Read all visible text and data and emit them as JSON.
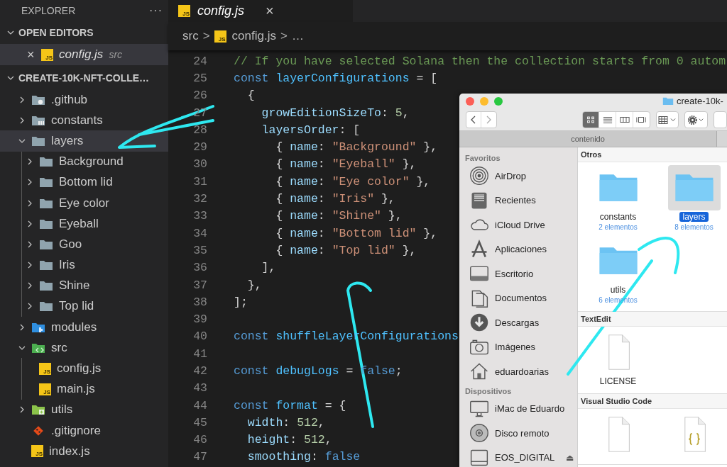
{
  "sidebar": {
    "title": "EXPLORER",
    "more": "···",
    "open_editors": {
      "title": "OPEN EDITORS",
      "expanded": true,
      "files": [
        {
          "close": "×",
          "badge": "JS",
          "name": "config.js",
          "folder": "src",
          "selected": true
        }
      ]
    },
    "project": {
      "title": "CREATE-10K-NFT-COLLE…",
      "expanded": true,
      "tree": [
        {
          "name": ".github",
          "kind": "github",
          "expanded": false,
          "selected": false
        },
        {
          "name": "constants",
          "kind": "constants",
          "expanded": false,
          "selected": false
        },
        {
          "name": "layers",
          "kind": "folder",
          "expanded": true,
          "selected": true,
          "children": [
            {
              "name": "Background",
              "kind": "folder",
              "expanded": false,
              "selected": false
            },
            {
              "name": "Bottom lid",
              "kind": "folder",
              "expanded": false,
              "selected": false
            },
            {
              "name": "Eye color",
              "kind": "folder",
              "expanded": false,
              "selected": false
            },
            {
              "name": "Eyeball",
              "kind": "folder",
              "expanded": false,
              "selected": false
            },
            {
              "name": "Goo",
              "kind": "folder",
              "expanded": false,
              "selected": false
            },
            {
              "name": "Iris",
              "kind": "folder",
              "expanded": false,
              "selected": false
            },
            {
              "name": "Shine",
              "kind": "folder",
              "expanded": false,
              "selected": false
            },
            {
              "name": "Top lid",
              "kind": "folder",
              "expanded": false,
              "selected": false
            }
          ]
        },
        {
          "name": "modules",
          "kind": "modules",
          "expanded": false,
          "selected": false
        },
        {
          "name": "src",
          "kind": "src",
          "expanded": true,
          "selected": false,
          "children": [
            {
              "name": "config.js",
              "kind": "js",
              "badge": "JS",
              "selected": false
            },
            {
              "name": "main.js",
              "kind": "js",
              "badge": "JS",
              "selected": false
            }
          ]
        },
        {
          "name": "utils",
          "kind": "utils",
          "expanded": false,
          "selected": false
        },
        {
          "name": ".gitignore",
          "kind": "git",
          "selected": false
        },
        {
          "name": "index.js",
          "kind": "js",
          "badge": "JS",
          "selected": false
        }
      ]
    }
  },
  "editor": {
    "tabs": [
      {
        "badge": "JS",
        "name": "config.js",
        "close": "×",
        "selected": true
      }
    ],
    "breadcrumb": [
      {
        "kind": "text",
        "text": "src"
      },
      {
        "kind": "sep",
        "text": ">"
      },
      {
        "kind": "file",
        "badge": "JS",
        "text": "config.js"
      },
      {
        "kind": "sep",
        "text": ">"
      },
      {
        "kind": "text",
        "text": "…"
      }
    ],
    "lines": [
      {
        "n": "24",
        "tokens": [
          {
            "text": "// If you have selected Solana then the collection starts from 0 autom",
            "kind": "comment"
          }
        ]
      },
      {
        "n": "25",
        "tokens": [
          {
            "text": "const",
            "kind": "kw"
          },
          {
            "text": " layerConfigurations",
            "kind": "var"
          },
          {
            "text": " = [",
            "kind": "punc"
          }
        ]
      },
      {
        "n": "26",
        "tokens": [
          {
            "text": "  {",
            "kind": "punc"
          }
        ]
      },
      {
        "n": "27",
        "tokens": [
          {
            "text": "    growEditionSizeTo",
            "kind": "prop"
          },
          {
            "text": ": ",
            "kind": "punc"
          },
          {
            "text": "5",
            "kind": "num"
          },
          {
            "text": ",",
            "kind": "punc"
          }
        ]
      },
      {
        "n": "28",
        "tokens": [
          {
            "text": "    layersOrder",
            "kind": "prop"
          },
          {
            "text": ": [",
            "kind": "punc"
          }
        ]
      },
      {
        "n": "29",
        "tokens": [
          {
            "text": "      { ",
            "kind": "punc"
          },
          {
            "text": "name",
            "kind": "prop"
          },
          {
            "text": ": ",
            "kind": "punc"
          },
          {
            "text": "\"Background\"",
            "kind": "str"
          },
          {
            "text": " },",
            "kind": "punc"
          }
        ]
      },
      {
        "n": "30",
        "tokens": [
          {
            "text": "      { ",
            "kind": "punc"
          },
          {
            "text": "name",
            "kind": "prop"
          },
          {
            "text": ": ",
            "kind": "punc"
          },
          {
            "text": "\"Eyeball\"",
            "kind": "str"
          },
          {
            "text": " },",
            "kind": "punc"
          }
        ]
      },
      {
        "n": "31",
        "tokens": [
          {
            "text": "      { ",
            "kind": "punc"
          },
          {
            "text": "name",
            "kind": "prop"
          },
          {
            "text": ": ",
            "kind": "punc"
          },
          {
            "text": "\"Eye color\"",
            "kind": "str"
          },
          {
            "text": " },",
            "kind": "punc"
          }
        ]
      },
      {
        "n": "32",
        "tokens": [
          {
            "text": "      { ",
            "kind": "punc"
          },
          {
            "text": "name",
            "kind": "prop"
          },
          {
            "text": ": ",
            "kind": "punc"
          },
          {
            "text": "\"Iris\"",
            "kind": "str"
          },
          {
            "text": " },",
            "kind": "punc"
          }
        ]
      },
      {
        "n": "33",
        "tokens": [
          {
            "text": "      { ",
            "kind": "punc"
          },
          {
            "text": "name",
            "kind": "prop"
          },
          {
            "text": ": ",
            "kind": "punc"
          },
          {
            "text": "\"Shine\"",
            "kind": "str"
          },
          {
            "text": " },",
            "kind": "punc"
          }
        ]
      },
      {
        "n": "34",
        "tokens": [
          {
            "text": "      { ",
            "kind": "punc"
          },
          {
            "text": "name",
            "kind": "prop"
          },
          {
            "text": ": ",
            "kind": "punc"
          },
          {
            "text": "\"Bottom lid\"",
            "kind": "str"
          },
          {
            "text": " },",
            "kind": "punc"
          }
        ]
      },
      {
        "n": "35",
        "tokens": [
          {
            "text": "      { ",
            "kind": "punc"
          },
          {
            "text": "name",
            "kind": "prop"
          },
          {
            "text": ": ",
            "kind": "punc"
          },
          {
            "text": "\"Top lid\"",
            "kind": "str"
          },
          {
            "text": " },",
            "kind": "punc"
          }
        ]
      },
      {
        "n": "36",
        "tokens": [
          {
            "text": "    ],",
            "kind": "punc"
          }
        ]
      },
      {
        "n": "37",
        "tokens": [
          {
            "text": "  },",
            "kind": "punc"
          }
        ]
      },
      {
        "n": "38",
        "tokens": [
          {
            "text": "];",
            "kind": "punc"
          }
        ]
      },
      {
        "n": "39"
      },
      {
        "n": "40",
        "tokens": [
          {
            "text": "const",
            "kind": "kw"
          },
          {
            "text": " shuffleLayerConfigurations",
            "kind": "var"
          }
        ]
      },
      {
        "n": "41"
      },
      {
        "n": "42",
        "tokens": [
          {
            "text": "const",
            "kind": "kw"
          },
          {
            "text": " debugLogs",
            "kind": "var"
          },
          {
            "text": " = ",
            "kind": "punc"
          },
          {
            "text": "false",
            "kind": "kw"
          },
          {
            "text": ";",
            "kind": "punc"
          }
        ]
      },
      {
        "n": "43"
      },
      {
        "n": "44",
        "tokens": [
          {
            "text": "const",
            "kind": "kw"
          },
          {
            "text": " format",
            "kind": "var"
          },
          {
            "text": " = {",
            "kind": "punc"
          }
        ]
      },
      {
        "n": "45",
        "tokens": [
          {
            "text": "  width",
            "kind": "prop"
          },
          {
            "text": ": ",
            "kind": "punc"
          },
          {
            "text": "512",
            "kind": "num"
          },
          {
            "text": ",",
            "kind": "punc"
          }
        ]
      },
      {
        "n": "46",
        "tokens": [
          {
            "text": "  height",
            "kind": "prop"
          },
          {
            "text": ": ",
            "kind": "punc"
          },
          {
            "text": "512",
            "kind": "num"
          },
          {
            "text": ",",
            "kind": "punc"
          }
        ]
      },
      {
        "n": "47",
        "tokens": [
          {
            "text": "  smoothing",
            "kind": "prop"
          },
          {
            "text": ": ",
            "kind": "punc"
          },
          {
            "text": "false",
            "kind": "kw"
          }
        ]
      }
    ]
  },
  "finder": {
    "title": "create-10k-",
    "view_buttons": [
      {
        "kind": "icons",
        "selected": true
      },
      {
        "kind": "list",
        "selected": false
      },
      {
        "kind": "columns",
        "selected": false
      },
      {
        "kind": "gallery",
        "selected": false
      }
    ],
    "tab": "contenido",
    "sidebar": [
      {
        "heading": "Favoritos",
        "items": [
          {
            "name": "AirDrop",
            "kind": "airdrop"
          },
          {
            "name": "Recientes",
            "kind": "recent"
          },
          {
            "name": "iCloud Drive",
            "kind": "cloud"
          },
          {
            "name": "Aplicaciones",
            "kind": "apps"
          },
          {
            "name": "Escritorio",
            "kind": "desktop"
          },
          {
            "name": "Documentos",
            "kind": "docs"
          },
          {
            "name": "Descargas",
            "kind": "download"
          },
          {
            "name": "Imágenes",
            "kind": "camera"
          },
          {
            "name": "eduardoarias",
            "kind": "home"
          }
        ]
      },
      {
        "heading": "Dispositivos",
        "items": [
          {
            "name": "iMac de Eduardo",
            "kind": "imac"
          },
          {
            "name": "Disco remoto",
            "kind": "disc"
          },
          {
            "name": "EOS_DIGITAL",
            "kind": "drive",
            "eject": "⏏"
          }
        ]
      }
    ],
    "sections": [
      {
        "title": "Otros",
        "items": [
          {
            "kind": "folder",
            "name": "constants",
            "sub": "2 elementos",
            "selected": false
          },
          {
            "kind": "folder",
            "name": "layers",
            "sub": "8 elementos",
            "selected": true
          },
          {
            "kind": "folder",
            "name": "utils",
            "sub": "6 elementos",
            "selected": false
          }
        ]
      },
      {
        "title": "TextEdit",
        "items": [
          {
            "kind": "doc",
            "name": "LICENSE",
            "selected": false
          }
        ]
      },
      {
        "title": "Visual Studio Code",
        "items": [
          {
            "kind": "doc",
            "selected": false
          },
          {
            "kind": "json",
            "selected": false
          }
        ]
      }
    ]
  }
}
